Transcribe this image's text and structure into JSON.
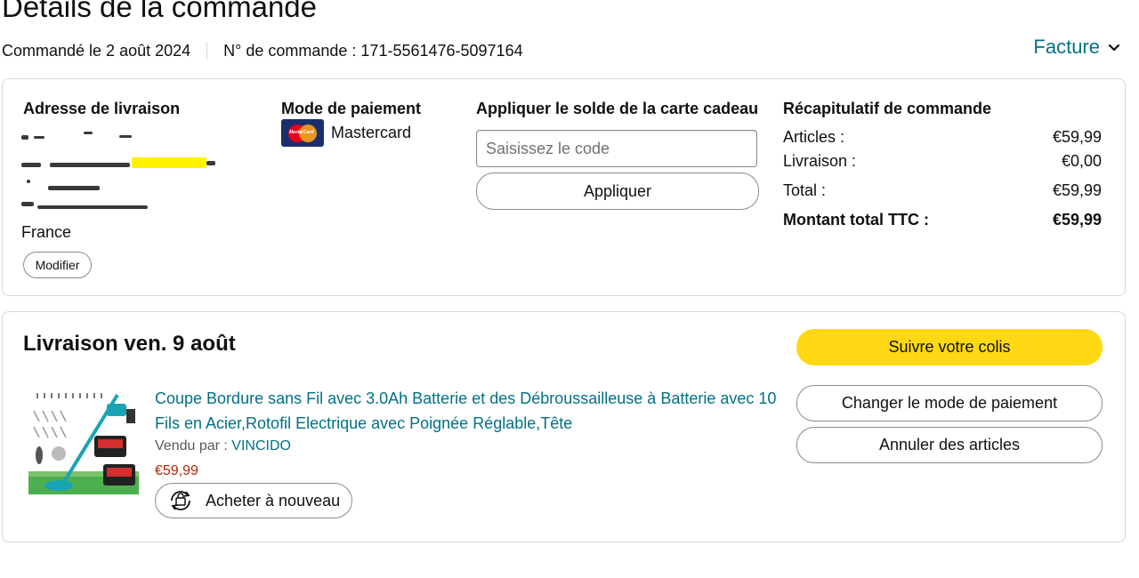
{
  "header": {
    "title": "Détails de la commande",
    "order_date": "Commandé le 2 août 2024",
    "order_number": "N° de commande : 171-5561476-5097164",
    "invoice_label": "Facture"
  },
  "address": {
    "heading": "Adresse de livraison",
    "country": "France",
    "modify_label": "Modifier"
  },
  "payment": {
    "heading": "Mode de paiement",
    "method": "Mastercard",
    "card_logo_text": "MasterCard"
  },
  "gift_card": {
    "heading": "Appliquer le solde de la carte cadeau",
    "placeholder": "Saisissez le code",
    "apply_label": "Appliquer"
  },
  "summary": {
    "heading": "Récapitulatif de commande",
    "rows": [
      {
        "label": "Articles :",
        "value": "€59,99"
      },
      {
        "label": "Livraison :",
        "value": "€0,00"
      },
      {
        "label": "Total :",
        "value": "€59,99"
      },
      {
        "label": "Montant total TTC :",
        "value": "€59,99"
      }
    ]
  },
  "shipment": {
    "title": "Livraison ven. 9 août",
    "track_label": "Suivre votre colis",
    "change_payment_label": "Changer le mode de paiement",
    "cancel_label": "Annuler des articles",
    "product": {
      "title": "Coupe Bordure sans Fil avec 3.0Ah Batterie et des Débroussailleuse à Batterie avec 10 Fils en Acier,Rotofil Electrique avec Poignée Réglable,Tête",
      "sold_by_label": "Vendu par : ",
      "seller": "VINCIDO",
      "price": "€59,99",
      "buy_again_label": "Acheter à nouveau"
    }
  },
  "colors": {
    "link": "#007185",
    "price": "#b12704",
    "button_yellow": "#ffd814",
    "border": "#d5d9d9"
  }
}
